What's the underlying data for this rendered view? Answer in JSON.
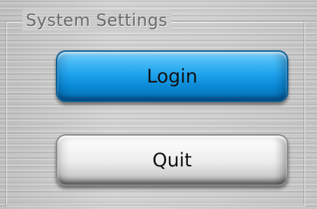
{
  "group": {
    "title": "System Settings"
  },
  "buttons": {
    "login_label": "Login",
    "quit_label": "Quit"
  },
  "colors": {
    "login_button": "#1fa4ee",
    "quit_button": "#ececec",
    "background": "#c9c9c9",
    "legend_text": "#6b6b6b"
  }
}
